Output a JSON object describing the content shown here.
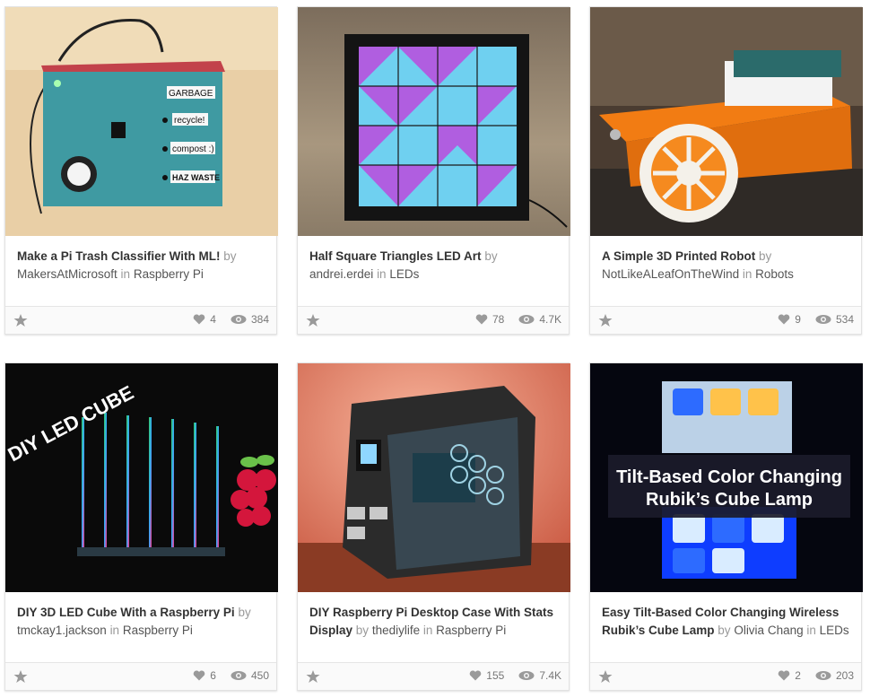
{
  "connector_by": "by",
  "connector_in": "in",
  "cards": [
    {
      "title": "Make a Pi Trash Classifier With ML!",
      "author": "MakersAtMicrosoft",
      "category": "Raspberry Pi",
      "likes": "4",
      "views": "384",
      "image_text": [
        "GARBAGE",
        "recycle!",
        "compost :)",
        "HAZ WASTE"
      ]
    },
    {
      "title": "Half Square Triangles LED Art",
      "author": "andrei.erdei",
      "category": "LEDs",
      "likes": "78",
      "views": "4.7K"
    },
    {
      "title": "A Simple 3D Printed Robot",
      "author": "NotLikeALeafOnTheWind",
      "category": "Robots",
      "likes": "9",
      "views": "534"
    },
    {
      "title": "DIY 3D LED Cube With a Raspberry Pi",
      "author": "tmckay1.jackson",
      "category": "Raspberry Pi",
      "likes": "6",
      "views": "450",
      "image_text": [
        "DIY LED CUBE"
      ]
    },
    {
      "title": "DIY Raspberry Pi Desktop Case With Stats Display",
      "author": "thediylife",
      "category": "Raspberry Pi",
      "likes": "155",
      "views": "7.4K"
    },
    {
      "title": "Easy Tilt-Based Color Changing Wireless Rubik’s Cube Lamp",
      "author": "Olivia Chang",
      "category": "LEDs",
      "likes": "2",
      "views": "203",
      "image_text": [
        "Tilt-Based Color Changing",
        "Rubik’s Cube Lamp"
      ]
    }
  ],
  "icons": {
    "favorite": "star-icon",
    "like": "heart-icon",
    "views": "eye-icon"
  }
}
